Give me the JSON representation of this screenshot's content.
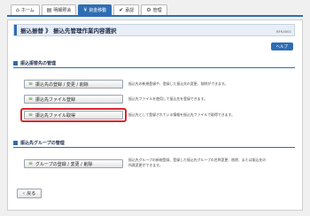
{
  "nav": {
    "tabs": [
      {
        "icon": "house-icon",
        "glyph": "⌂",
        "label": "ホーム"
      },
      {
        "icon": "statement-icon",
        "glyph": "▤",
        "label": "明細照会"
      },
      {
        "icon": "yen-icon",
        "glyph": "¥",
        "label": "資金移動"
      },
      {
        "icon": "check-icon",
        "glyph": "✔",
        "label": "承認"
      },
      {
        "icon": "gear-icon",
        "glyph": "⚙",
        "label": "管理"
      }
    ],
    "active_index": 2
  },
  "page": {
    "title": "振込振替 》 振込先管理作業内容選択",
    "screen_id": "BFK4001",
    "help_label": "ヘルプ"
  },
  "sections": [
    {
      "heading": "振込振替先の管理",
      "rows": [
        {
          "button": "振込先の登録 / 変更 / 削除",
          "description": "振込先の新規登録や、登録した振込先の変更、削除ができます。"
        },
        {
          "button": "振込先ファイル登録",
          "description": "振込先ファイルを使用して振込先を登録できます。"
        },
        {
          "button": "振込先ファイル取得",
          "description": "振込先として登録されている情報を振込先ファイルで取得できます。"
        }
      ]
    },
    {
      "heading": "振込先グループの管理",
      "rows": [
        {
          "button": "グループの登録 / 変更 / 削除",
          "description_lines": [
            "振込先グループの新規登録、登録した振込先グループの名称変更、削除、または振込先の",
            "所属変更ができます。"
          ]
        }
      ]
    }
  ],
  "back_label": "戻る",
  "colors": {
    "accent": "#2e6db4",
    "highlight": "#d9262b",
    "button_icon": "#4b8a2f"
  }
}
